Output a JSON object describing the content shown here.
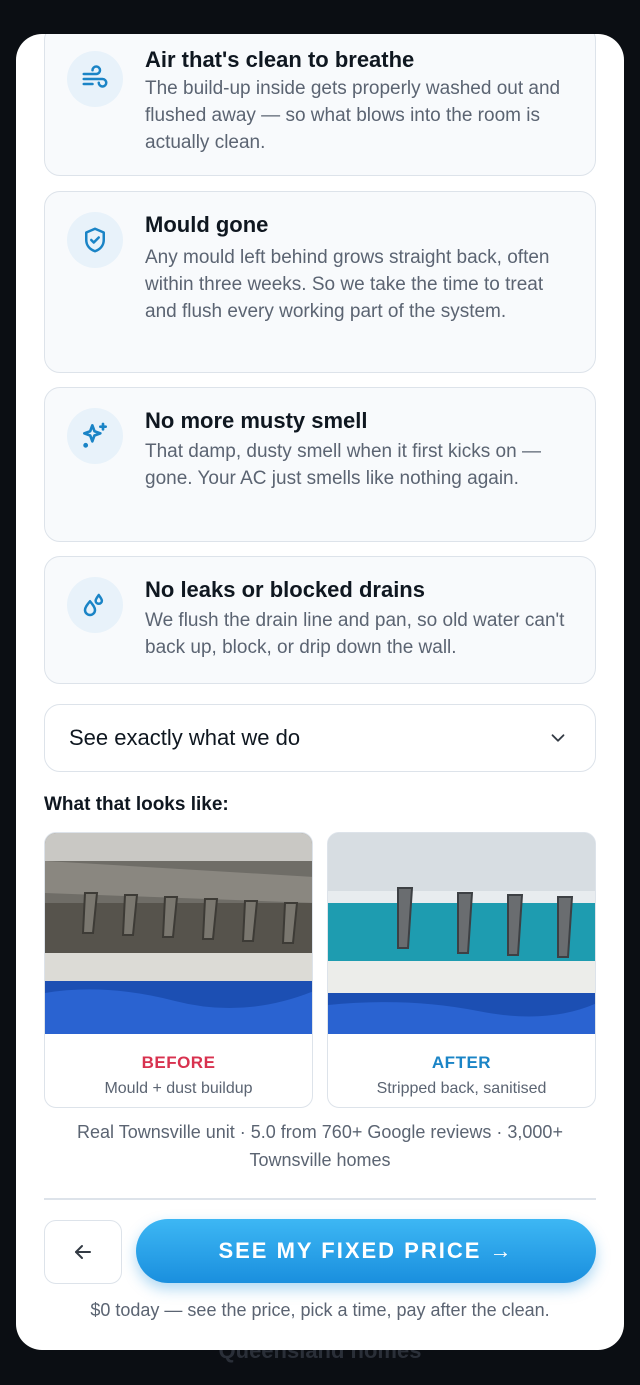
{
  "backdrop": {
    "text": "Queensland homes"
  },
  "modal": {
    "close_label": "×"
  },
  "benefits": [
    {
      "icon": "wind-icon",
      "title": "Air that's clean to breathe",
      "body": "The build-up inside gets properly washed out and flushed away — so what blows into the room is actually clean."
    },
    {
      "icon": "shield-check-icon",
      "title": "Mould gone",
      "body": "Any mould left behind grows straight back, often within three weeks. So we take the time to treat and flush every working part of the system."
    },
    {
      "icon": "sparkles-icon",
      "title": "No more musty smell",
      "body": "That damp, dusty smell when it first kicks on — gone. Your AC just smells like nothing again."
    },
    {
      "icon": "droplets-icon",
      "title": "No leaks or blocked drains",
      "body": "We flush the drain line and pan, so old water can't back up, block, or drip down the wall."
    }
  ],
  "accordion": {
    "label": "See exactly what we do"
  },
  "gallery": {
    "heading": "What that looks like:",
    "before": {
      "tag": "BEFORE",
      "caption": "Mould + dust buildup",
      "color": "#d8324f"
    },
    "after": {
      "tag": "AFTER",
      "caption": "Stripped back, sanitised",
      "color": "#1a84c6"
    }
  },
  "reviews_text": "Real Townsville unit · 5.0 from 760+ Google reviews · 3,000+ Townsville homes",
  "actions": {
    "back_label": "←",
    "cta_label": "SEE MY FIXED PRICE →",
    "footnote": "$0 today — see the price, pick a time, pay after the clean."
  },
  "colors": {
    "accent": "#1a8fde",
    "card_bg": "#f8fafc",
    "icon_blue": "#1a84c6"
  }
}
